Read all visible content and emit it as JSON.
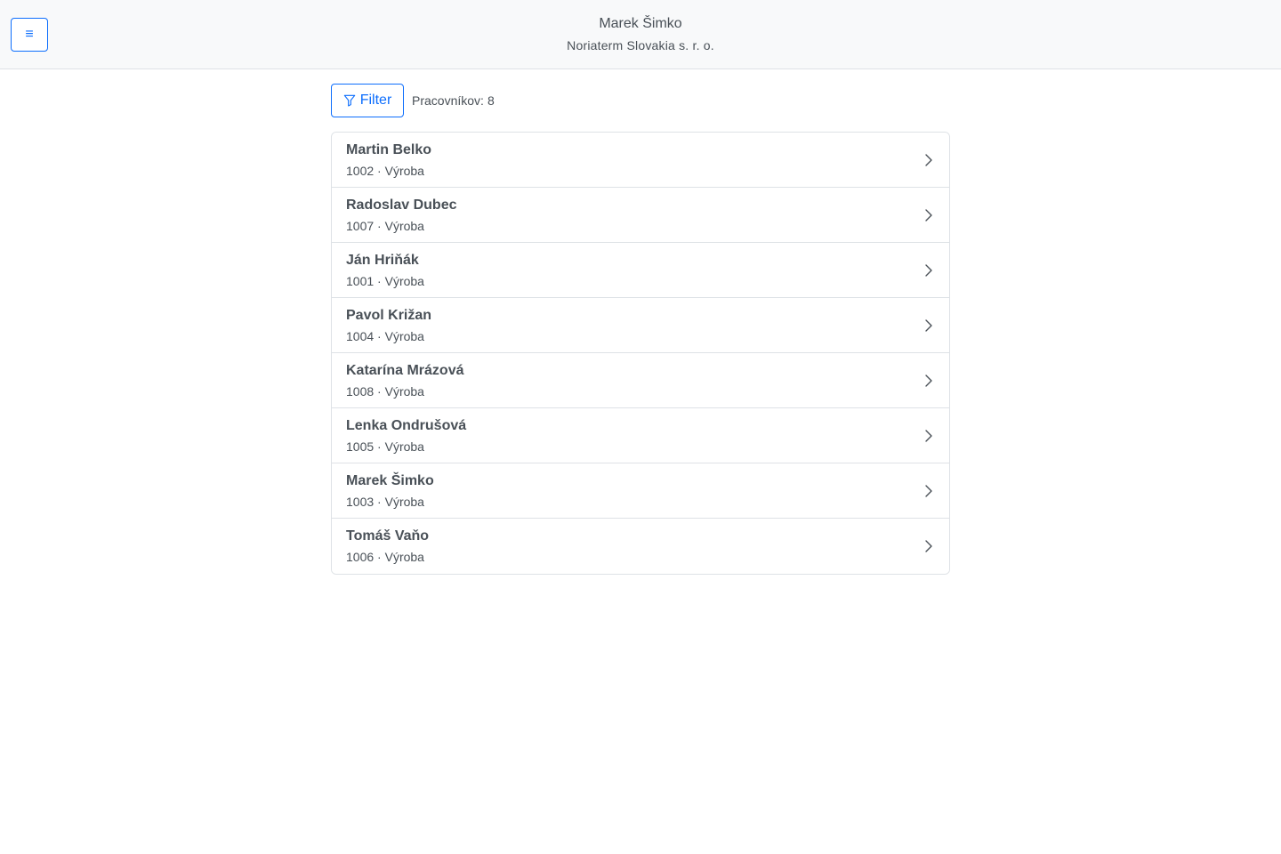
{
  "header": {
    "menu_icon": "hamburger-icon",
    "menu_glyph": "≡",
    "title": "Marek Šimko",
    "subtitle": "Noriaterm Slovakia s. r. o."
  },
  "toolbar": {
    "filter_label": "Filter",
    "filter_icon": "filter-icon",
    "count_label": "Pracovníkov:",
    "count_value": "8"
  },
  "colors": {
    "primary": "#0d6efd",
    "text": "#495057",
    "border": "#dee2e6",
    "header_bg": "#f8f9fa"
  },
  "workers": [
    {
      "name": "Martin Belko",
      "id": "1002",
      "department": "Výroba"
    },
    {
      "name": "Radoslav Dubec",
      "id": "1007",
      "department": "Výroba"
    },
    {
      "name": "Ján Hriňák",
      "id": "1001",
      "department": "Výroba"
    },
    {
      "name": "Pavol Križan",
      "id": "1004",
      "department": "Výroba"
    },
    {
      "name": "Katarína Mrázová",
      "id": "1008",
      "department": "Výroba"
    },
    {
      "name": "Lenka Ondrušová",
      "id": "1005",
      "department": "Výroba"
    },
    {
      "name": "Marek Šimko",
      "id": "1003",
      "department": "Výroba"
    },
    {
      "name": "Tomáš Vaňo",
      "id": "1006",
      "department": "Výroba"
    }
  ]
}
